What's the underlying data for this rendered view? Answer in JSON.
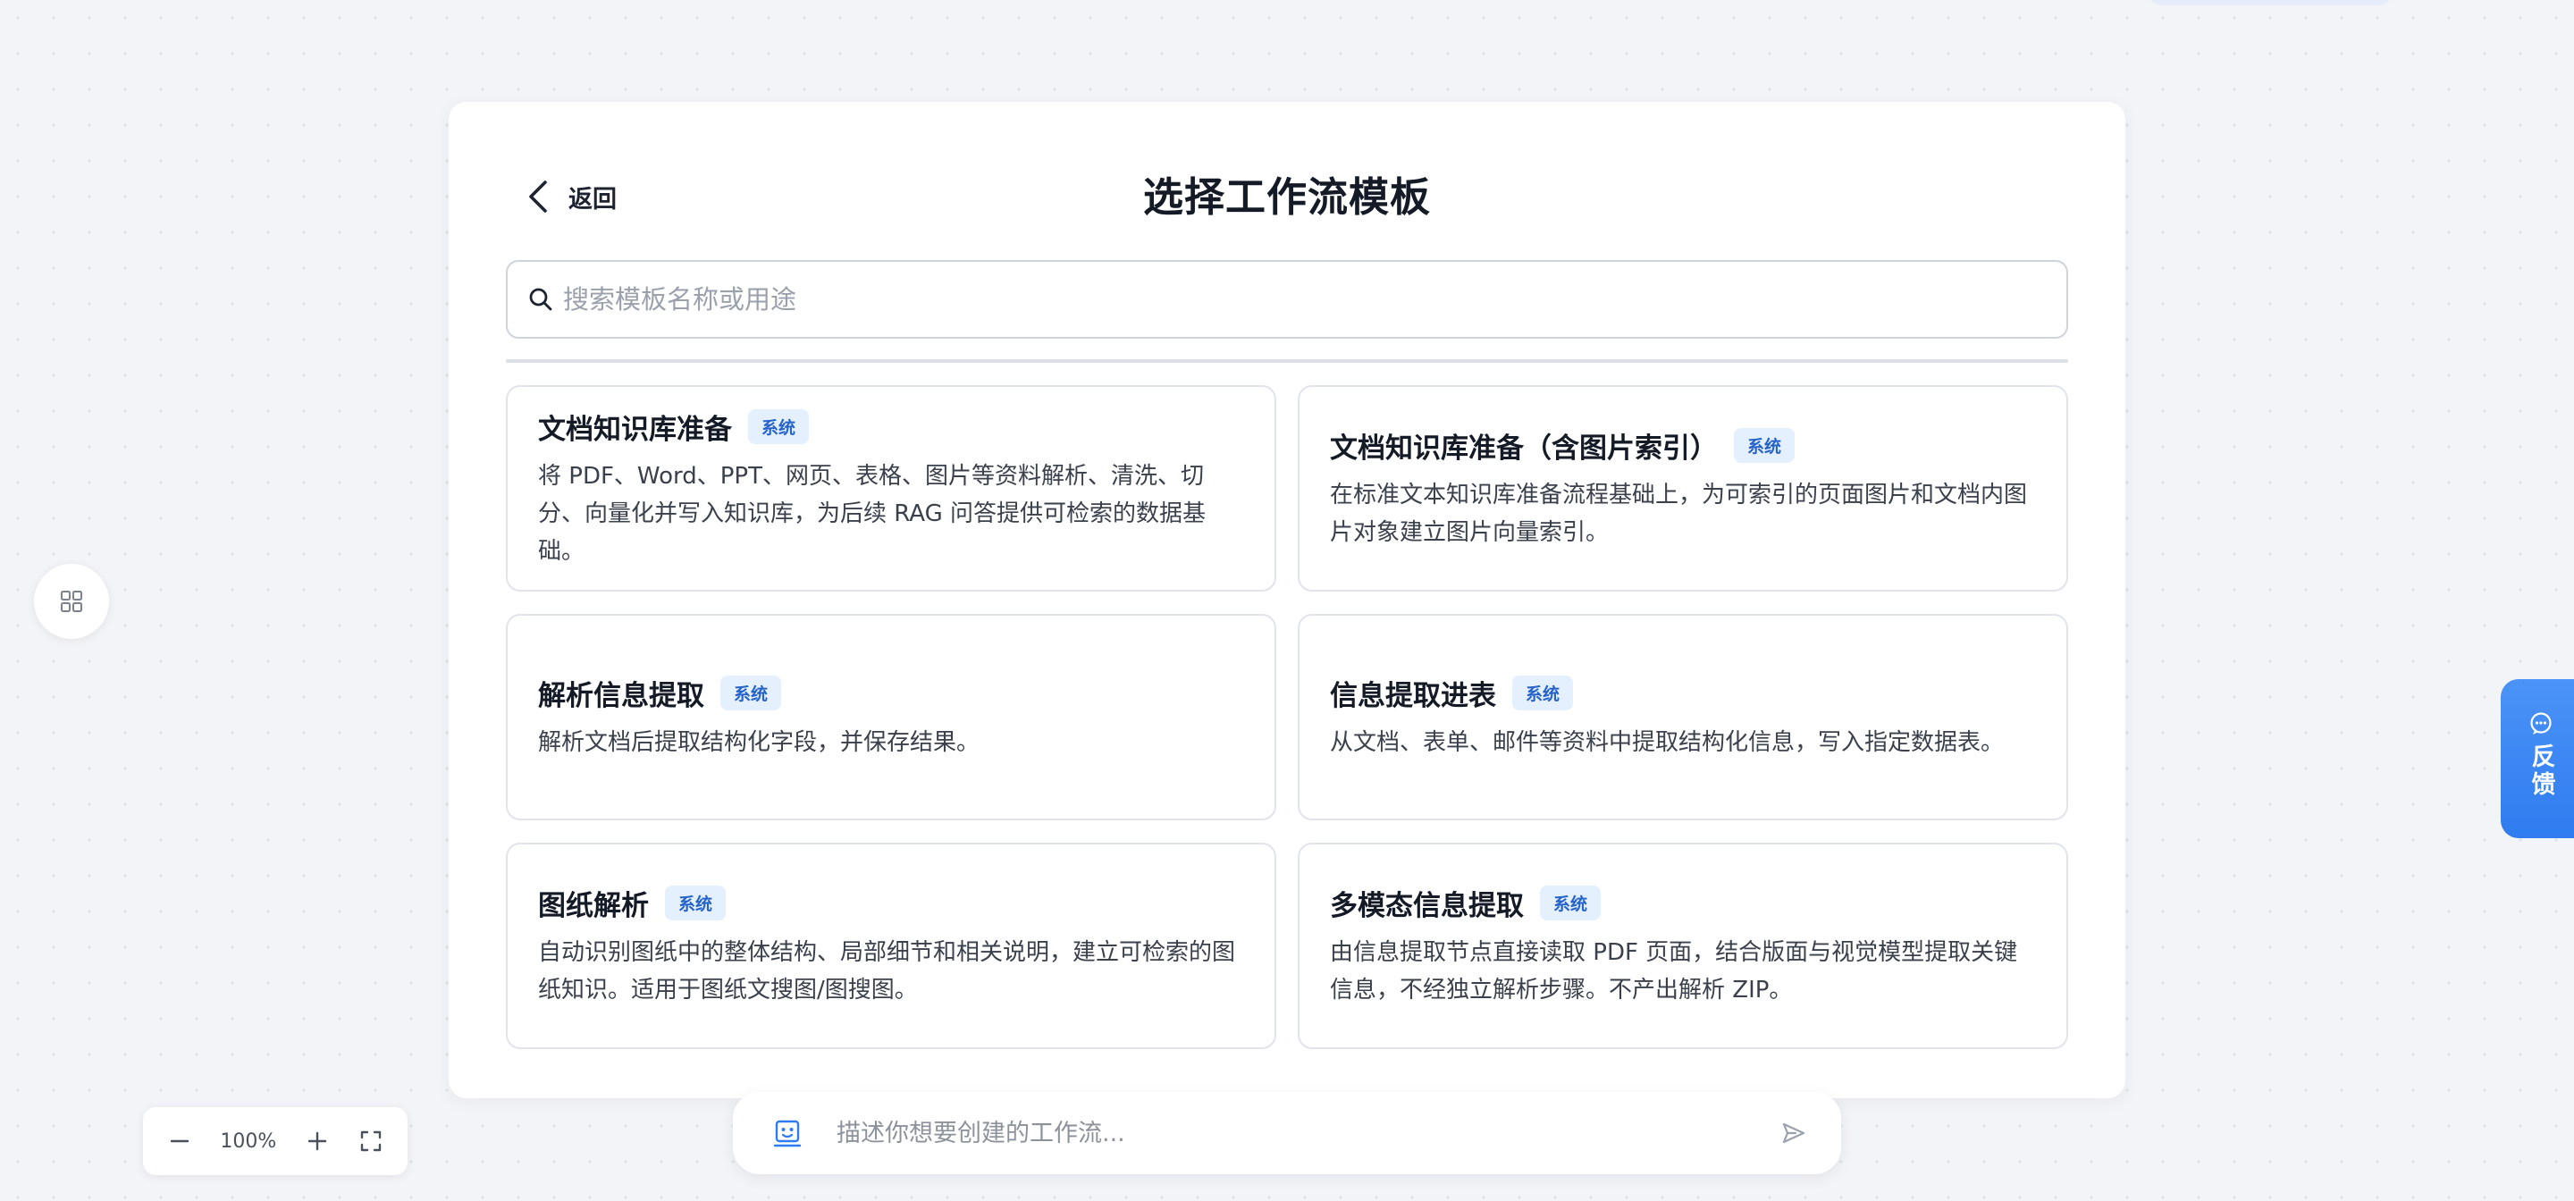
{
  "modal": {
    "back_label": "返回",
    "title": "选择工作流模板",
    "search_placeholder": "搜索模板名称或用途",
    "cards": [
      {
        "title": "文档知识库准备",
        "badge": "系统",
        "desc": "将 PDF、Word、PPT、网页、表格、图片等资料解析、清洗、切分、向量化并写入知识库，为后续 RAG 问答提供可检索的数据基础。"
      },
      {
        "title": "文档知识库准备（含图片索引）",
        "badge": "系统",
        "desc": "在标准文本知识库准备流程基础上，为可索引的页面图片和文档内图片对象建立图片向量索引。"
      },
      {
        "title": "解析信息提取",
        "badge": "系统",
        "desc": "解析文档后提取结构化字段，并保存结果。"
      },
      {
        "title": "信息提取进表",
        "badge": "系统",
        "desc": "从文档、表单、邮件等资料中提取结构化信息，写入指定数据表。"
      },
      {
        "title": "图纸解析",
        "badge": "系统",
        "desc": "自动识别图纸中的整体结构、局部细节和相关说明，建立可检索的图纸知识。适用于图纸文搜图/图搜图。"
      },
      {
        "title": "多模态信息提取",
        "badge": "系统",
        "desc": "由信息提取节点直接读取 PDF 页面，结合版面与视觉模型提取关键信息，不经独立解析步骤。不产出解析 ZIP。"
      }
    ]
  },
  "feedback": {
    "label": "反馈"
  },
  "zoom": {
    "level": "100%"
  },
  "composer": {
    "placeholder": "描述你想要创建的工作流..."
  },
  "icons": {
    "back": "chevron-left-icon",
    "search": "search-icon",
    "grid": "grid-icon",
    "feedback": "chat-bubble-icon",
    "zoom_out": "minus-icon",
    "zoom_in": "plus-icon",
    "fullscreen": "fullscreen-icon",
    "bot": "bot-icon",
    "send": "send-icon"
  },
  "colors": {
    "accent": "#2f7cf0",
    "badge_bg": "#e5f0ff",
    "badge_text": "#2563c9"
  }
}
